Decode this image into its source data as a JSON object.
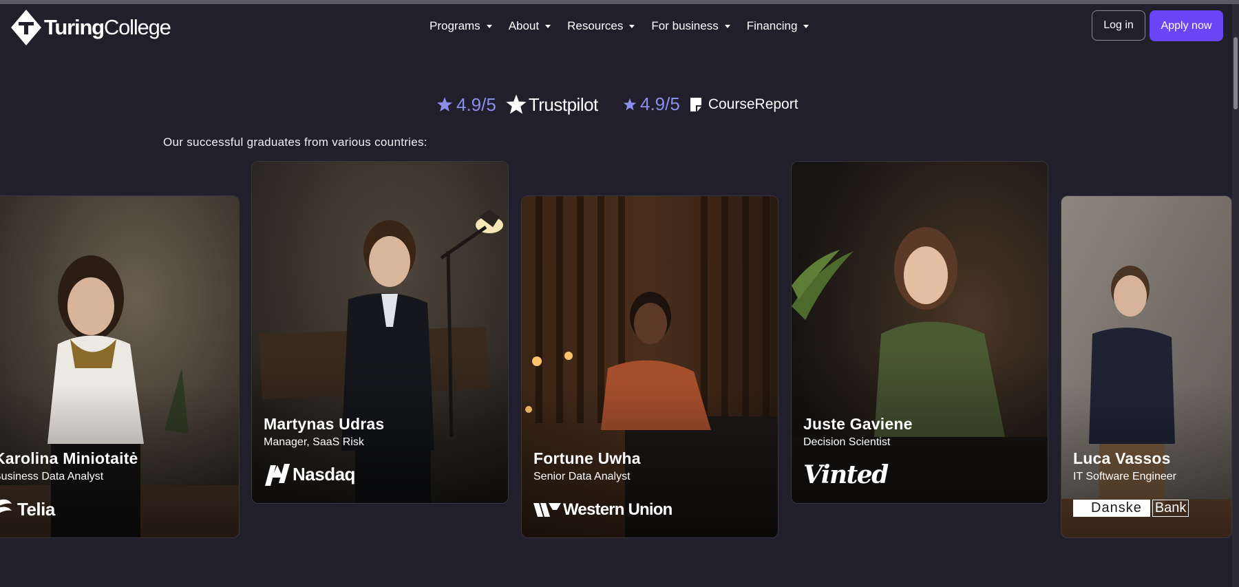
{
  "header": {
    "brand_bold": "Turing",
    "brand_light": "College",
    "nav": [
      {
        "label": "Programs"
      },
      {
        "label": "About"
      },
      {
        "label": "Resources"
      },
      {
        "label": "For business"
      },
      {
        "label": "Financing"
      }
    ],
    "login_label": "Log in",
    "apply_label": "Apply now"
  },
  "ratings": [
    {
      "value": "4.9/5",
      "source": "Trustpilot"
    },
    {
      "value": "4.9/5",
      "source": "CourseReport"
    }
  ],
  "graduates": {
    "heading": "Our successful graduates from various countries:",
    "cards": [
      {
        "name": "Karolina Miniotaitė",
        "role": "Business Data Analyst",
        "company": "Telia"
      },
      {
        "name": "Martynas Udras",
        "role": "Manager, SaaS Risk",
        "company": "Nasdaq"
      },
      {
        "name": "Fortune Uwha",
        "role": "Senior Data Analyst",
        "company": "Western Union"
      },
      {
        "name": "Juste Gaviene",
        "role": "Decision Scientist",
        "company": "Vinted"
      },
      {
        "name": "Luca Vassos",
        "role": "IT Software Engineer",
        "company": "Danske Bank",
        "company_left": "Danske",
        "company_right": "Bank"
      }
    ]
  },
  "colors": {
    "background": "#221f2c",
    "accent": "#6a45f6",
    "rating": "#8b8eea"
  }
}
